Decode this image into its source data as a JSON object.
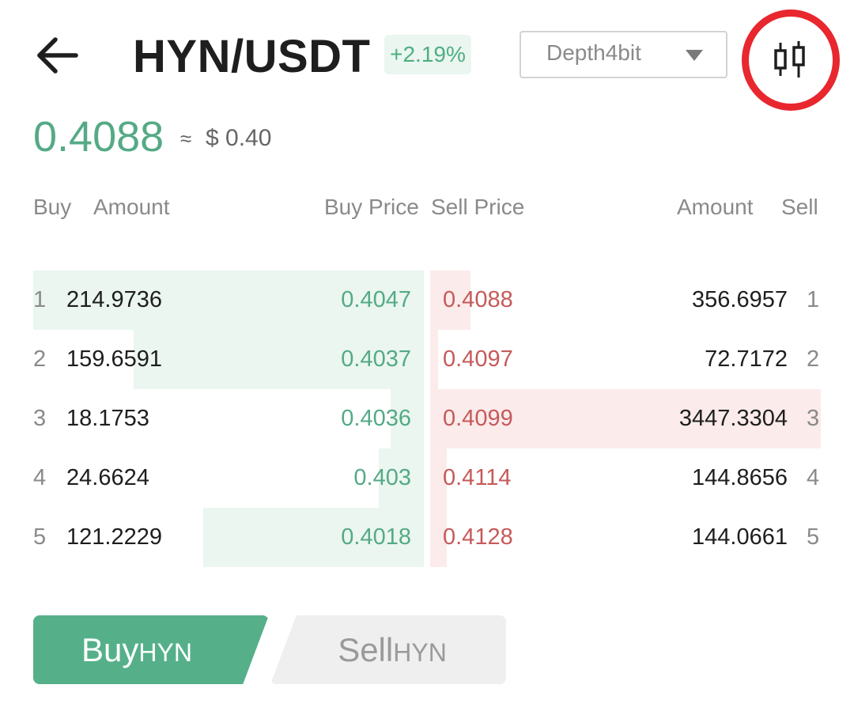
{
  "header": {
    "pair": "HYN/USDT",
    "change": "+2.19%",
    "depth_select": "Depth4bit"
  },
  "price": {
    "last": "0.4088",
    "approx_symbol": "≈",
    "usd": "$ 0.40"
  },
  "columns": {
    "buy": "Buy",
    "buy_amount": "Amount",
    "buy_price": "Buy Price",
    "sell_price": "Sell Price",
    "sell_amount": "Amount",
    "sell": "Sell"
  },
  "orderbook": {
    "buy": [
      {
        "index": "1",
        "amount": "214.9736",
        "price": "0.4047",
        "depth": 1.0
      },
      {
        "index": "2",
        "amount": "159.6591",
        "price": "0.4037",
        "depth": 0.7426
      },
      {
        "index": "3",
        "amount": "18.1753",
        "price": "0.4036",
        "depth": 0.0845
      },
      {
        "index": "4",
        "amount": "24.6624",
        "price": "0.403",
        "depth": 0.1147
      },
      {
        "index": "5",
        "amount": "121.2229",
        "price": "0.4018",
        "depth": 0.5639
      }
    ],
    "sell": [
      {
        "index": "1",
        "amount": "356.6957",
        "price": "0.4088",
        "depth": 0.1035
      },
      {
        "index": "2",
        "amount": "72.7172",
        "price": "0.4097",
        "depth": 0.0211
      },
      {
        "index": "3",
        "amount": "3447.3304",
        "price": "0.4099",
        "depth": 1.0
      },
      {
        "index": "4",
        "amount": "144.8656",
        "price": "0.4114",
        "depth": 0.042
      },
      {
        "index": "5",
        "amount": "144.0661",
        "price": "0.4128",
        "depth": 0.0418
      }
    ]
  },
  "actions": {
    "buy": {
      "label": "Buy",
      "asset": "HYN"
    },
    "sell": {
      "label": "Sell",
      "asset": "HYN"
    }
  },
  "colors": {
    "up": "#55aa86",
    "down": "#c65a5a",
    "highlight": "#e8272f"
  },
  "icons": {
    "back": "arrow-left-icon",
    "kline": "candlestick-icon",
    "dropdown": "chevron-down-icon"
  }
}
